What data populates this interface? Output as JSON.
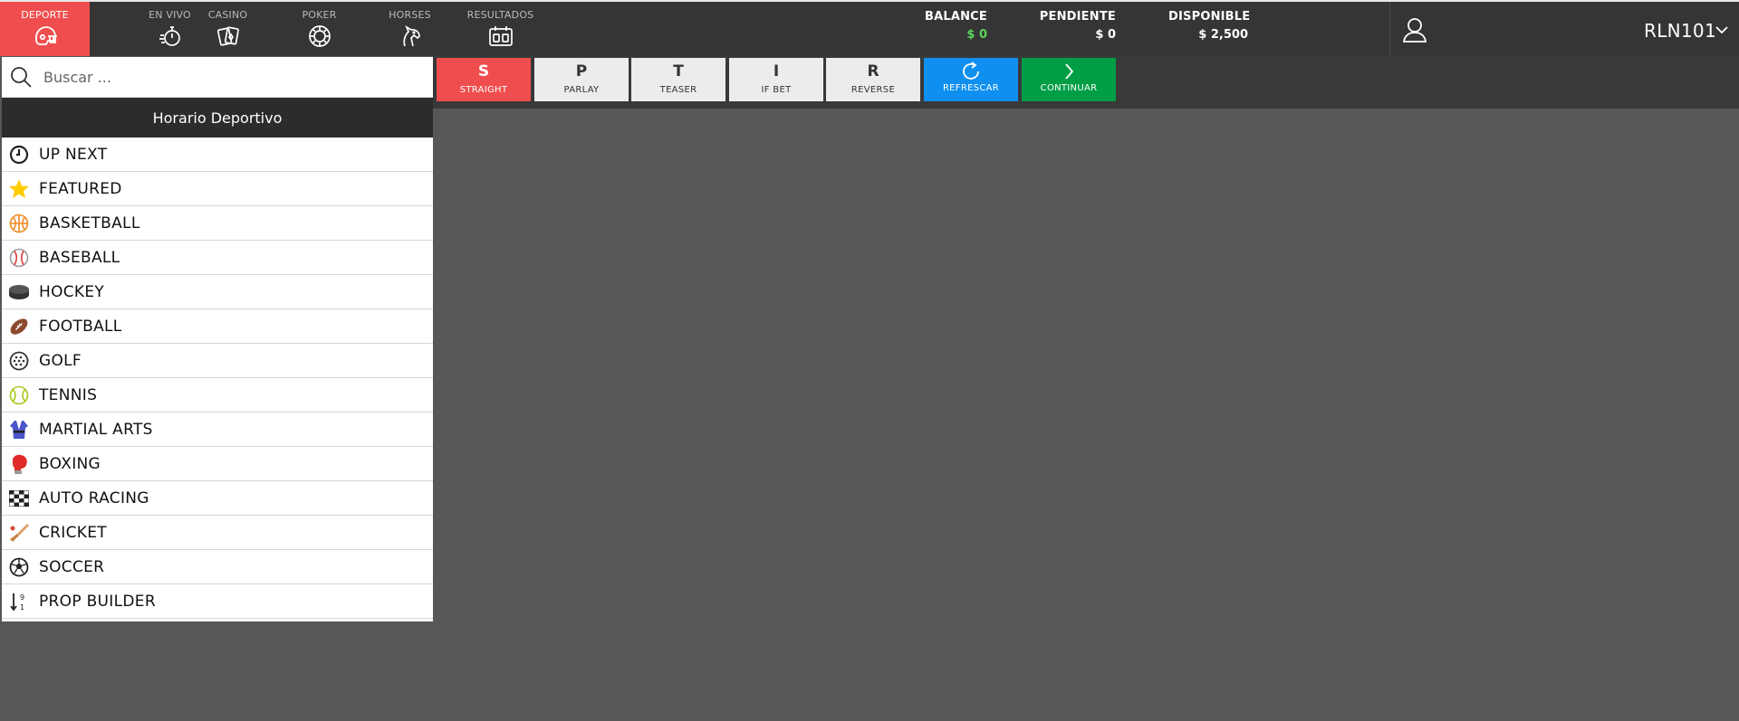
{
  "nav": {
    "items": [
      {
        "label": "DEPORTE",
        "icon": "helmet-icon"
      },
      {
        "label": "EN VIVO",
        "icon": "stopwatch-icon"
      },
      {
        "label": "CASINO",
        "icon": "cards-icon"
      },
      {
        "label": "POKER",
        "icon": "poker-chip-icon"
      },
      {
        "label": "HORSES",
        "icon": "horse-icon"
      },
      {
        "label": "RESULTADOS",
        "icon": "scoreboard-icon"
      }
    ]
  },
  "account": {
    "balance_label": "BALANCE",
    "balance_value": "$ 0",
    "pending_label": "PENDIENTE",
    "pending_value": "$ 0",
    "available_label": "DISPONIBLE",
    "available_value": "$ 2,500",
    "username": "RLN101"
  },
  "search": {
    "placeholder": "Buscar ..."
  },
  "schedule": {
    "title": "Horario Deportivo"
  },
  "sports": [
    {
      "label": "UP NEXT",
      "icon": "clock-icon"
    },
    {
      "label": "FEATURED",
      "icon": "star-icon"
    },
    {
      "label": "BASKETBALL",
      "icon": "basketball-icon"
    },
    {
      "label": "BASEBALL",
      "icon": "baseball-icon"
    },
    {
      "label": "HOCKEY",
      "icon": "hockey-puck-icon"
    },
    {
      "label": "FOOTBALL",
      "icon": "football-icon"
    },
    {
      "label": "GOLF",
      "icon": "golf-ball-icon"
    },
    {
      "label": "TENNIS",
      "icon": "tennis-ball-icon"
    },
    {
      "label": "MARTIAL ARTS",
      "icon": "martial-arts-icon"
    },
    {
      "label": "BOXING",
      "icon": "boxing-glove-icon"
    },
    {
      "label": "AUTO RACING",
      "icon": "checkered-flag-icon"
    },
    {
      "label": "CRICKET",
      "icon": "cricket-bat-icon"
    },
    {
      "label": "SOCCER",
      "icon": "soccer-ball-icon"
    },
    {
      "label": "PROP BUILDER",
      "icon": "sort-numeric-icon"
    }
  ],
  "bet_types": [
    {
      "letter": "S",
      "label": "STRAIGHT"
    },
    {
      "letter": "P",
      "label": "PARLAY"
    },
    {
      "letter": "T",
      "label": "TEASER"
    },
    {
      "letter": "I",
      "label": "IF BET"
    },
    {
      "letter": "R",
      "label": "REVERSE"
    }
  ],
  "actions": {
    "refresh_label": "REFRESCAR",
    "continue_label": "CONTINUAR"
  },
  "colors": {
    "accent_red": "#f04e4e",
    "refresh_blue": "#0f8ff0",
    "continue_green": "#009e45",
    "balance_green": "#5cd65c"
  }
}
